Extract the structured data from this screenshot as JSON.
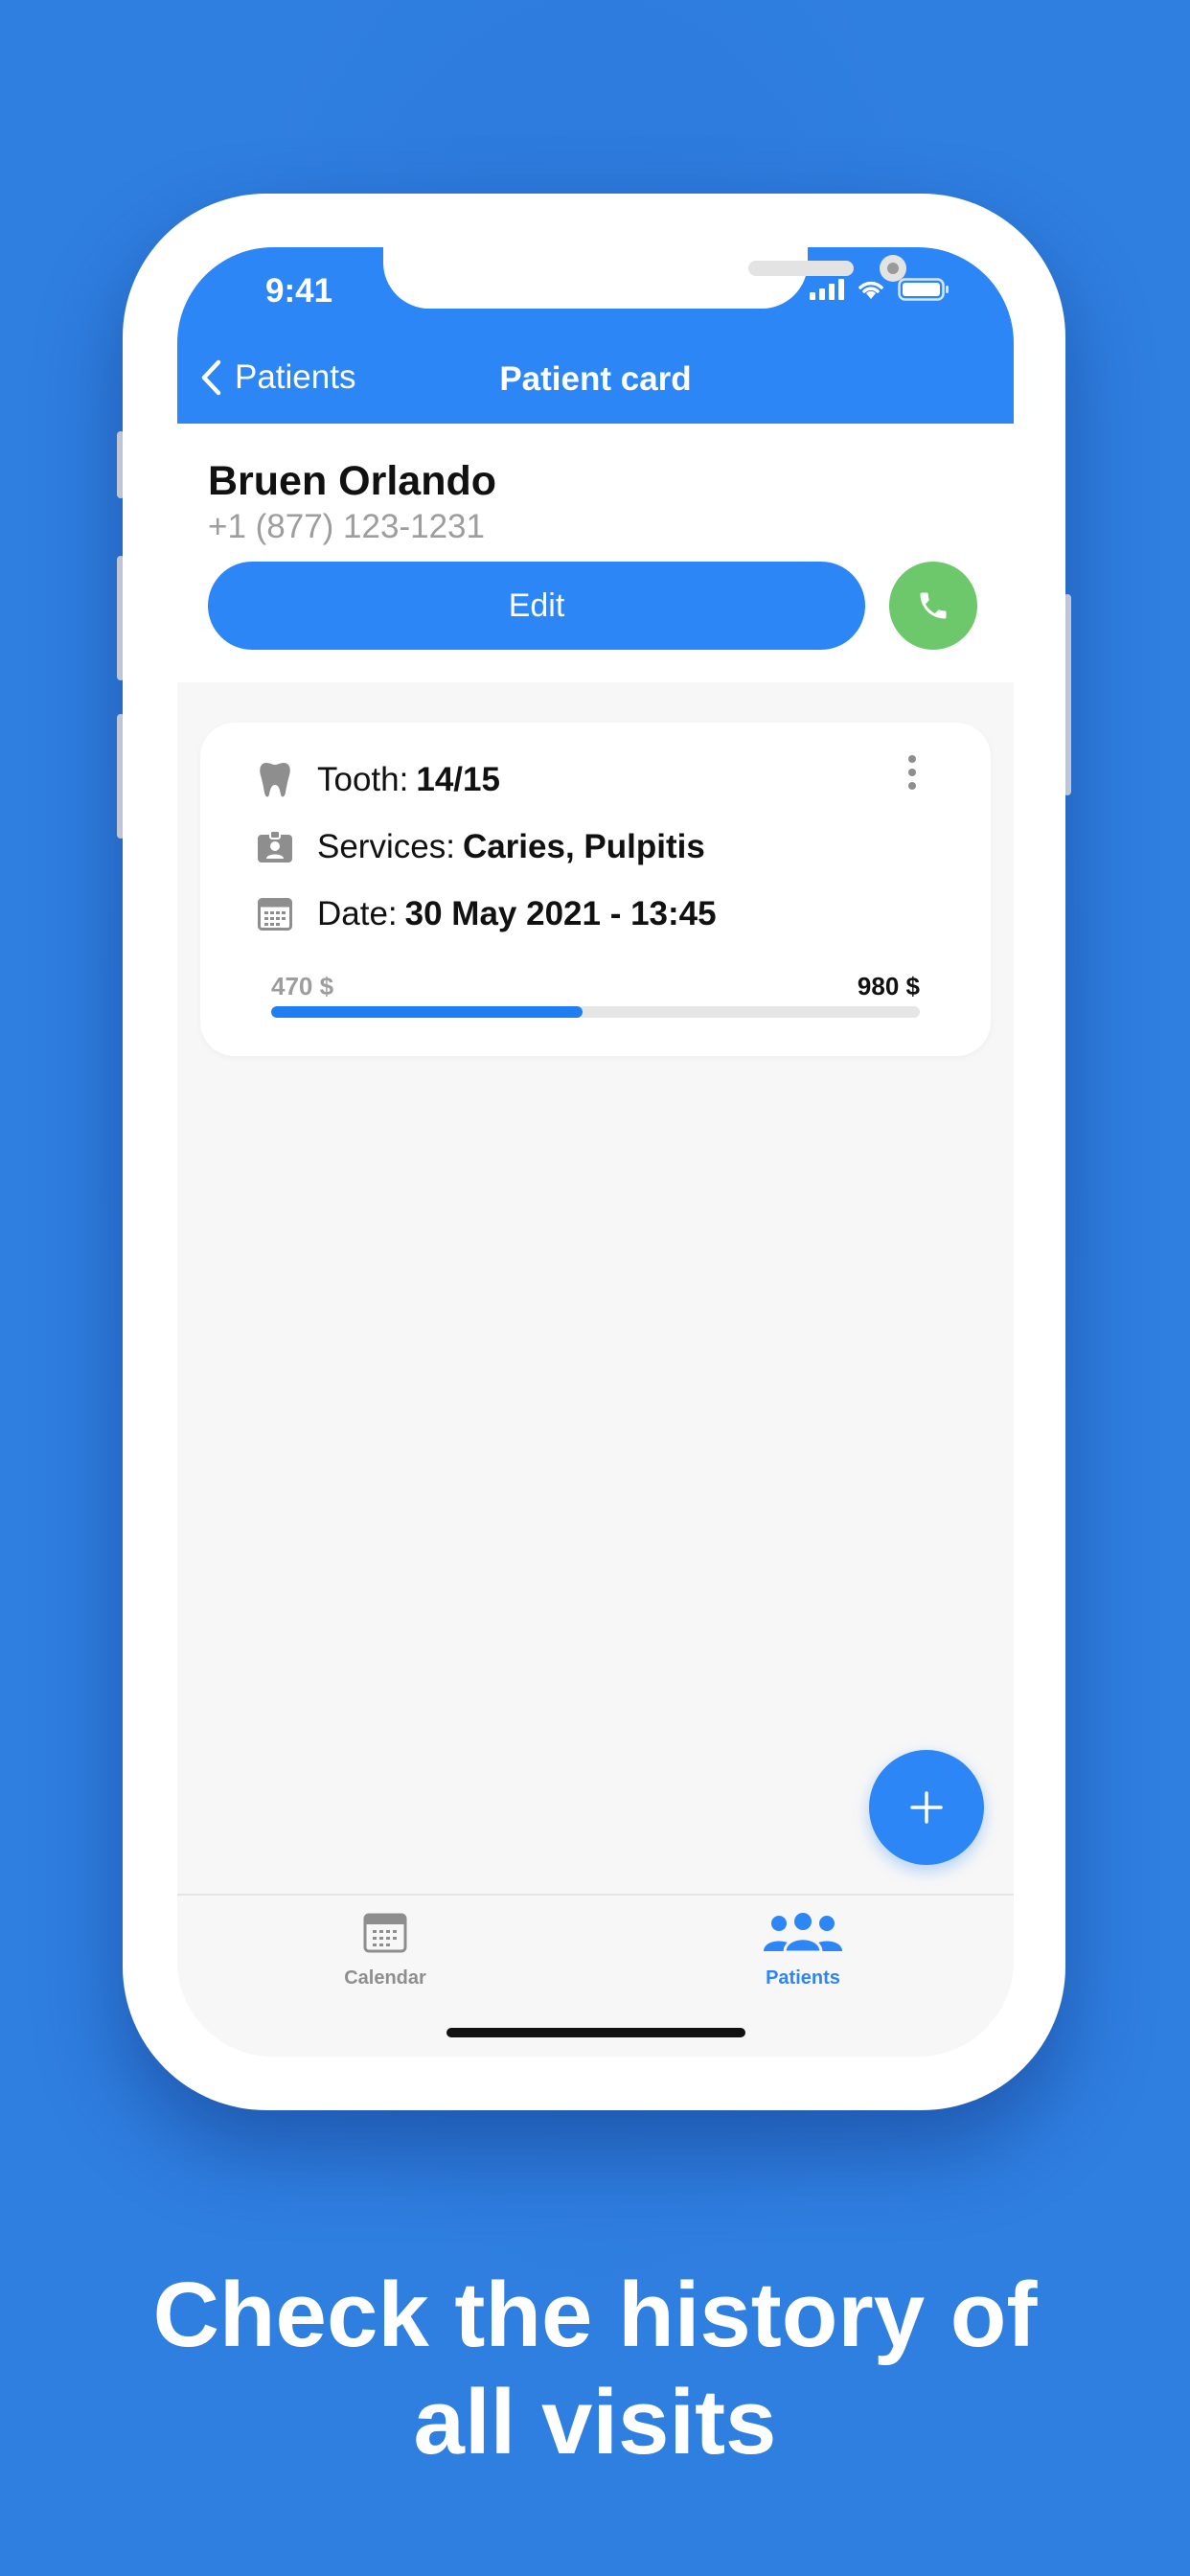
{
  "status_bar": {
    "time": "9:41"
  },
  "nav": {
    "back_label": "Patients",
    "title": "Patient card"
  },
  "patient": {
    "name": "Bruen Orlando",
    "phone": "+1 (877) 123-1231",
    "edit_label": "Edit"
  },
  "visit": {
    "tooth_label": "Tooth:",
    "tooth_value": "14/15",
    "services_label": "Services:",
    "services_value": "Caries, Pulpitis",
    "date_label": "Date:",
    "date_value": "30 May 2021 - 13:45",
    "paid": "470 $",
    "total": "980 $",
    "progress_fraction": 0.48
  },
  "tabs": [
    {
      "label": "Calendar",
      "icon": "calendar-icon",
      "active": false
    },
    {
      "label": "Patients",
      "icon": "people-icon",
      "active": true
    }
  ],
  "tagline": {
    "line1": "Check the history of",
    "line2": "all visits"
  },
  "colors": {
    "background": "#2f7fe1",
    "accent": "#2d86f6",
    "call": "#6cc86a",
    "progress": "#1f7ef2"
  }
}
